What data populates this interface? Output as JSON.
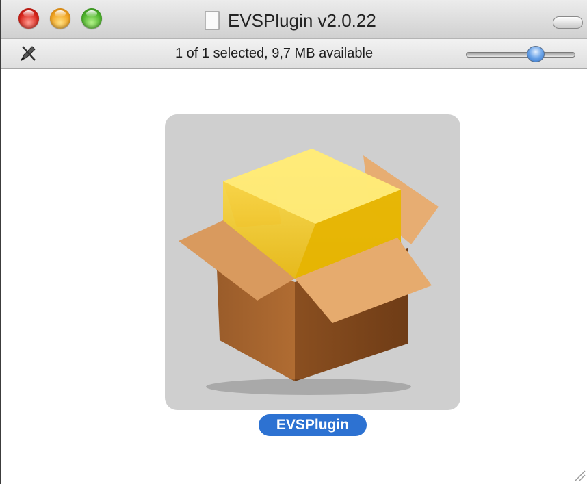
{
  "window": {
    "title": "EVSPlugin v2.0.22"
  },
  "statusbar": {
    "text": "1 of 1 selected, 9,7 MB available",
    "icon_size_slider_level": 0.58
  },
  "content": {
    "items": [
      {
        "label": "EVSPlugin",
        "icon": "package-icon",
        "selected": true
      }
    ]
  },
  "icons": {
    "close": "close-light-icon",
    "minimize": "minimize-light-icon",
    "zoom": "zoom-light-icon",
    "title": "document-icon",
    "toolbar_toggle": "toolbar-pill-icon",
    "edit": "pencil-icon",
    "resize": "resize-grip-icon"
  },
  "colors": {
    "selection": "#2d72d2",
    "icon_background": "#cfcfcf"
  }
}
